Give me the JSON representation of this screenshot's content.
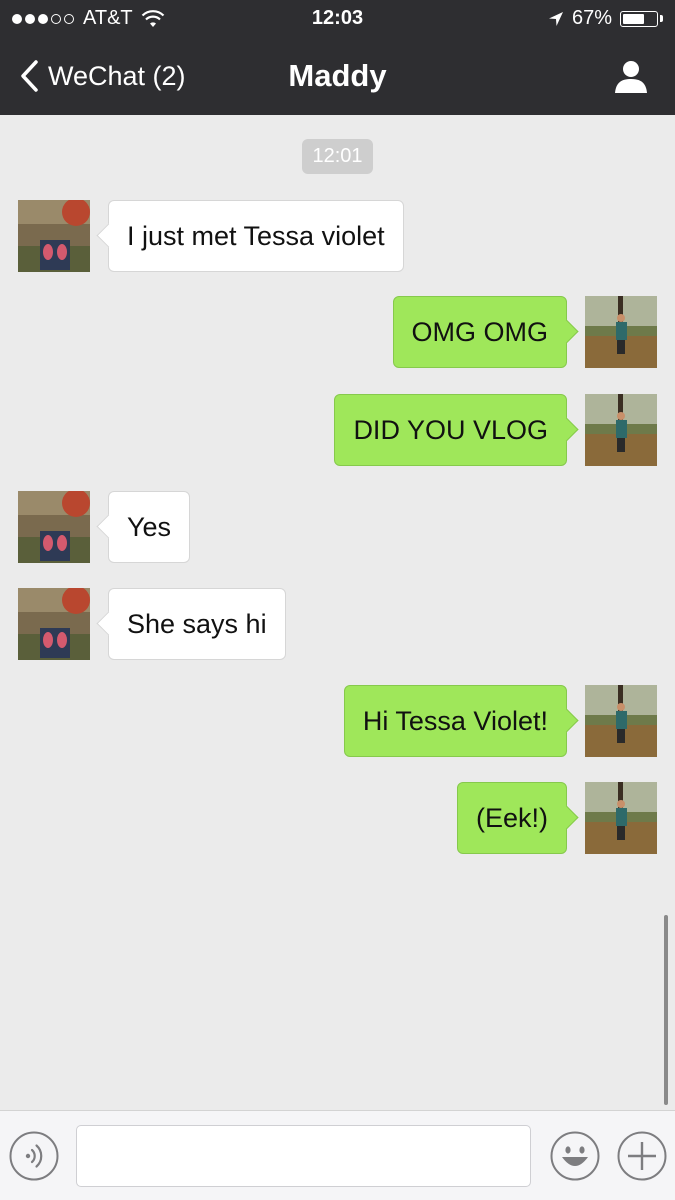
{
  "status_bar": {
    "carrier": "AT&T",
    "time": "12:03",
    "battery": "67%",
    "battery_level": 0.67
  },
  "nav": {
    "back_label": "WeChat (2)",
    "title": "Maddy"
  },
  "chat": {
    "timestamp": "12:01",
    "messages": [
      {
        "side": "left",
        "text": "I just met Tessa violet"
      },
      {
        "side": "right",
        "text": "OMG OMG"
      },
      {
        "side": "right",
        "text": "DID YOU VLOG"
      },
      {
        "side": "left",
        "text": "Yes"
      },
      {
        "side": "left",
        "text": "She says hi"
      },
      {
        "side": "right",
        "text": "Hi Tessa Violet!"
      },
      {
        "side": "right",
        "text": "(Eek!)"
      }
    ]
  },
  "input": {
    "value": "",
    "placeholder": ""
  },
  "icons": {
    "back": "chevron-left-icon",
    "profile": "person-icon",
    "voice": "voice-icon",
    "emoji": "smiley-icon",
    "more": "plus-icon"
  },
  "colors": {
    "header_bg": "#2e2e31",
    "chat_bg": "#ebebeb",
    "bubble_sent": "#9fe75a",
    "bubble_received": "#ffffff"
  }
}
